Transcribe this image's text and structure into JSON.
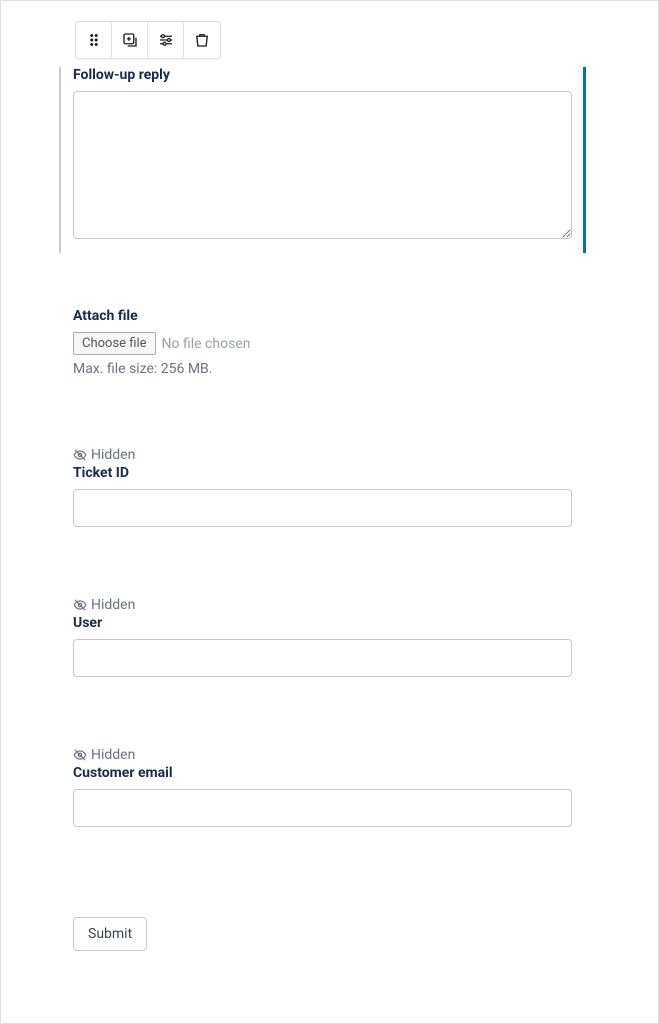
{
  "toolbar": {
    "drag_label": "Drag",
    "add_label": "Add block",
    "settings_label": "Settings",
    "delete_label": "Delete"
  },
  "fields": {
    "followup": {
      "label": "Follow-up reply"
    },
    "attach": {
      "label": "Attach file",
      "choose_btn": "Choose file",
      "no_file": "No file chosen",
      "help": "Max. file size: 256 MB."
    },
    "ticket_id": {
      "hidden": "Hidden",
      "label": "Ticket ID"
    },
    "user": {
      "hidden": "Hidden",
      "label": "User"
    },
    "customer_email": {
      "hidden": "Hidden",
      "label": "Customer email"
    }
  },
  "submit": {
    "label": "Submit"
  }
}
